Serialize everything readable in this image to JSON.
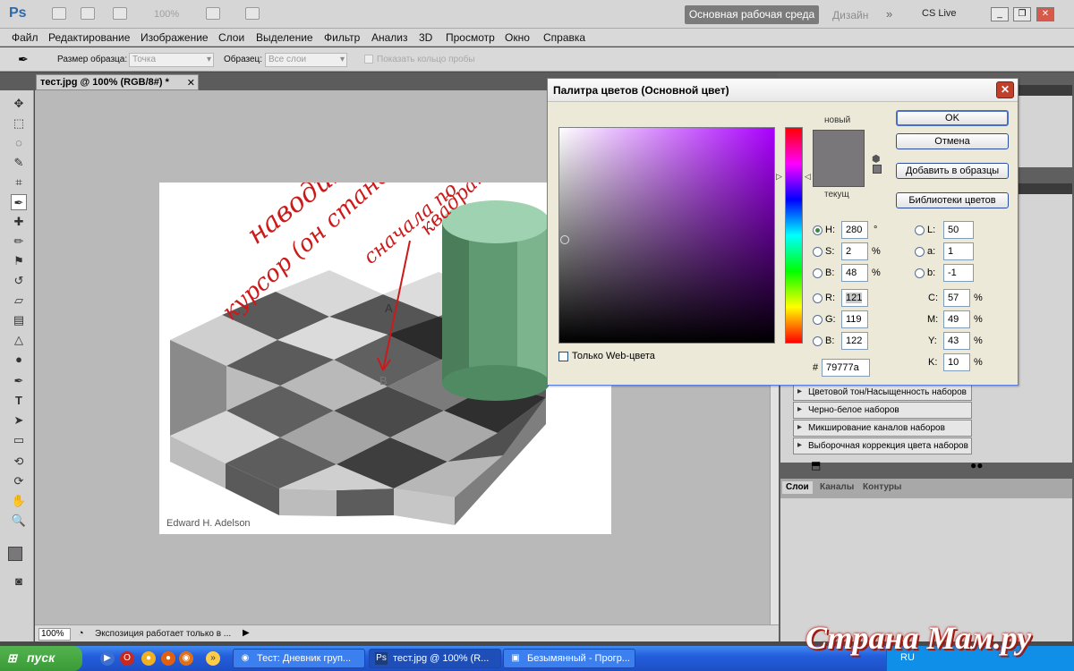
{
  "app": {
    "logo": "Ps",
    "zoom_display": "100%",
    "workspace": "Основная рабочая среда",
    "design": "Дизайн",
    "cs_live": "CS Live"
  },
  "menu": [
    "Файл",
    "Редактирование",
    "Изображение",
    "Слои",
    "Выделение",
    "Фильтр",
    "Анализ",
    "3D",
    "Просмотр",
    "Окно",
    "Справка"
  ],
  "options": {
    "sample_size_label": "Размер образца:",
    "sample_size_value": "Точка",
    "sample_label": "Образец:",
    "sample_value": "Все слои",
    "show_ring": "Показать кольцо пробы"
  },
  "document": {
    "tab_title": "тест.jpg @ 100% (RGB/8#) *",
    "credit": "Edward H. Adelson",
    "cell_a": "A",
    "cell_b": "B",
    "annotation_1": "наводим",
    "annotation_2": "курсор (он станет пипеткой)",
    "annotation_3": "сначала по",
    "annotation_4": "квадрату"
  },
  "status": {
    "zoom": "100%",
    "message": "Экспозиция работает только в ..."
  },
  "dialog": {
    "title": "Палитра цветов (Основной цвет)",
    "new_label": "новый",
    "current_label": "текущ",
    "buttons": {
      "ok": "OK",
      "cancel": "Отмена",
      "add_swatch": "Добавить в образцы",
      "libraries": "Библиотеки цветов"
    },
    "web_only": "Только Web-цвета",
    "hex_label": "#",
    "hex": "79777a",
    "hsb": {
      "h": "280",
      "s": "2",
      "b": "48"
    },
    "rgb": {
      "r": "121",
      "g": "119",
      "b": "122"
    },
    "lab": {
      "l": "50",
      "a": "1",
      "b": "-1"
    },
    "cmyk": {
      "c": "57",
      "m": "49",
      "y": "43",
      "k": "10"
    },
    "units": {
      "degree": "°",
      "percent": "%"
    },
    "labels": {
      "h": "H:",
      "s": "S:",
      "b": "B:",
      "r": "R:",
      "g": "G:",
      "bb": "B:",
      "l": "L:",
      "a": "a:",
      "lab_b": "b:",
      "c": "C:",
      "m": "M:",
      "y": "Y:",
      "k": "K:"
    },
    "current_color": "#79777a"
  },
  "panels": {
    "adjustments": [
      "Цветовой тон/Насыщенность наборов",
      "Черно-белое наборов",
      "Микширование каналов наборов",
      "Выборочная коррекция цвета наборов"
    ],
    "tabs": [
      "Слои",
      "Каналы",
      "Контуры"
    ]
  },
  "taskbar": {
    "start": "пуск",
    "tasks": [
      "Тест: Дневник груп...",
      "тест.jpg @ 100% (R...",
      "Безымянный - Прогр..."
    ],
    "lang": "RU"
  },
  "watermark": "Страна Мам.ру"
}
